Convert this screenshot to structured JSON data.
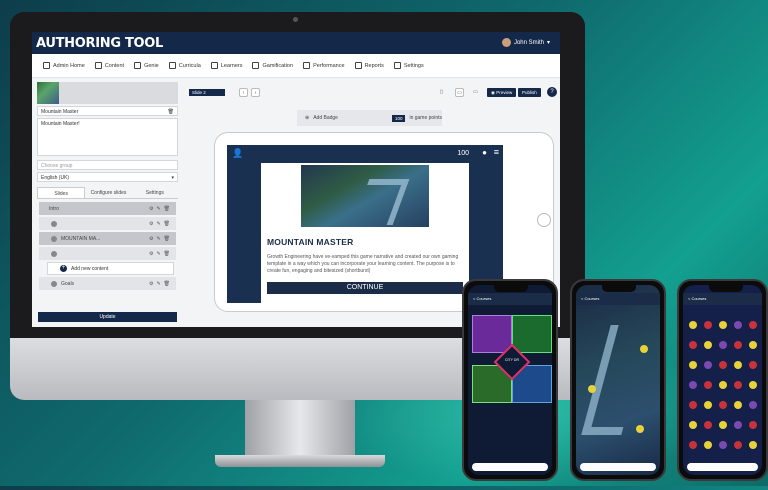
{
  "app": {
    "title": "AUTHORING TOOL",
    "user": "John Smith"
  },
  "nav": [
    {
      "label": "Admin Home",
      "icon": "wrench-icon"
    },
    {
      "label": "Content",
      "icon": "folder-icon"
    },
    {
      "label": "Genie",
      "icon": "genie-icon"
    },
    {
      "label": "Curricula",
      "icon": "curricula-icon"
    },
    {
      "label": "Learners",
      "icon": "learners-icon"
    },
    {
      "label": "Gamification",
      "icon": "gamepad-icon"
    },
    {
      "label": "Performance",
      "icon": "monitor-icon"
    },
    {
      "label": "Reports",
      "icon": "chart-icon"
    },
    {
      "label": "Settings",
      "icon": "gear-icon"
    }
  ],
  "left": {
    "name_value": "Mountain Master",
    "description_value": "Mountain Master!",
    "group_placeholder": "Choose group",
    "language_value": "English (UK)",
    "tabs": [
      "Slides",
      "Configure slides",
      "Settings"
    ],
    "rows": [
      "Intro",
      "",
      "MOUNTAIN MA...",
      ""
    ],
    "add_new": "Add new content",
    "goals_row": "Goals",
    "update_label": "Update"
  },
  "editor": {
    "slide_select": "Slide 2",
    "preview_label": "Preview",
    "publish_label": "Publish",
    "help_label": "?",
    "add_badge": "Add Badge",
    "points_value": "100",
    "points_label": "in game points"
  },
  "slide": {
    "score": "100",
    "title": "MOUNTAIN MASTER",
    "body": "Growth Engineering have ve-vamped this game narrative and created our own gaming template in a way which you can incorporate your learning content. The purpose is to create fun, engaging and bitesized (shortburst)",
    "continue_label": "CONTINUE"
  },
  "phones": [
    {
      "back_label": "< Courses",
      "center_label": "CITY DR"
    },
    {
      "back_label": "< Courses"
    },
    {
      "back_label": "< Courses"
    }
  ],
  "colors": {
    "navy": "#14284a",
    "teal_bg": "#13a090"
  }
}
